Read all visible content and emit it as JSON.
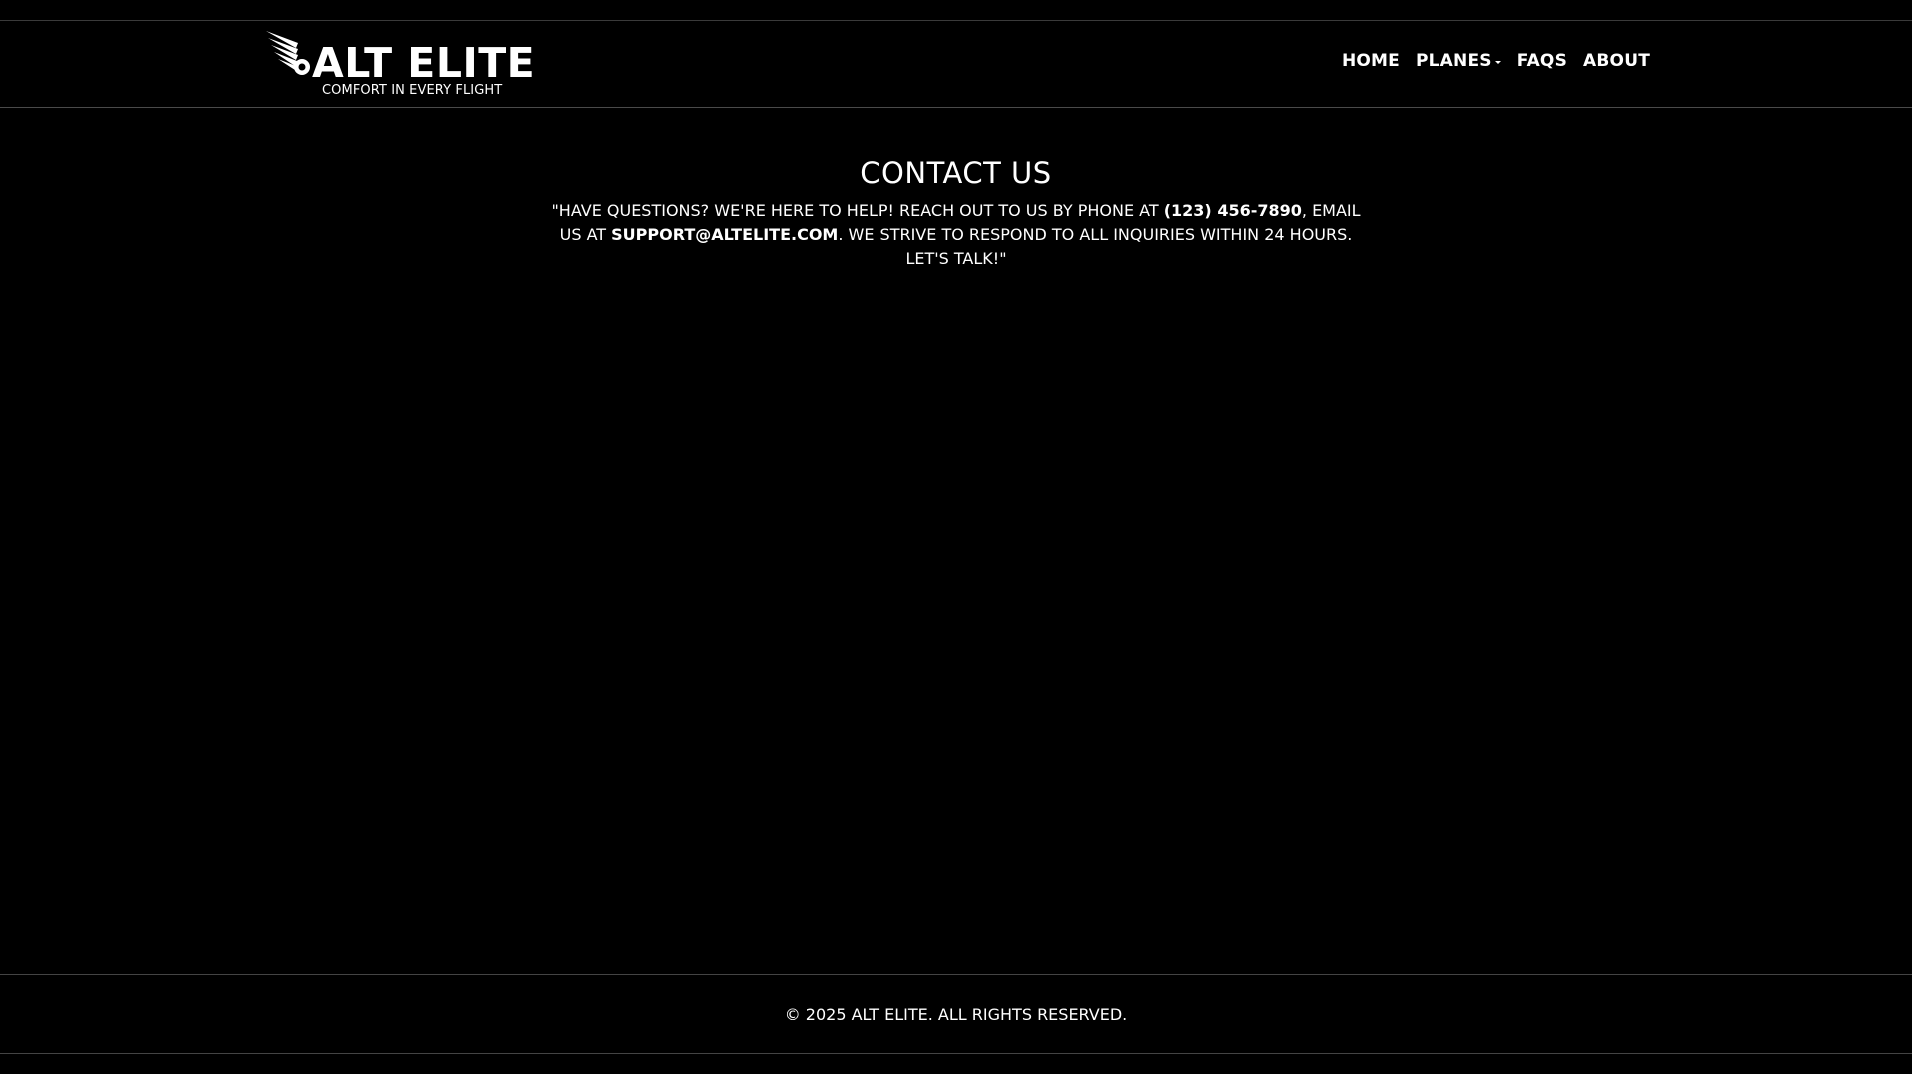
{
  "brand": {
    "name": "ALT ELITE",
    "tagline": "COMFORT IN EVERY FLIGHT",
    "logo_icon": "winged-wheel-icon"
  },
  "nav": {
    "items": [
      {
        "label": "HOME"
      },
      {
        "label": "PLANES",
        "has_dropdown": true
      },
      {
        "label": "FAQS"
      },
      {
        "label": "ABOUT"
      }
    ]
  },
  "contact": {
    "title": "CONTACT US",
    "text_1": "\"HAVE QUESTIONS? WE'RE HERE TO HELP! REACH OUT TO US BY PHONE AT ",
    "phone": "(123) 456-7890",
    "text_2": ", EMAIL US AT ",
    "email": "SUPPORT@ALTELITE.COM",
    "text_3": ". WE STRIVE TO RESPOND TO ALL INQUIRIES WITHIN 24 HOURS. LET'S TALK!\""
  },
  "footer": {
    "copyright": "© 2025 ALT ELITE. ALL RIGHTS RESERVED."
  },
  "colors": {
    "background": "#000000",
    "text": "#ffffff",
    "divider": "#444444"
  }
}
